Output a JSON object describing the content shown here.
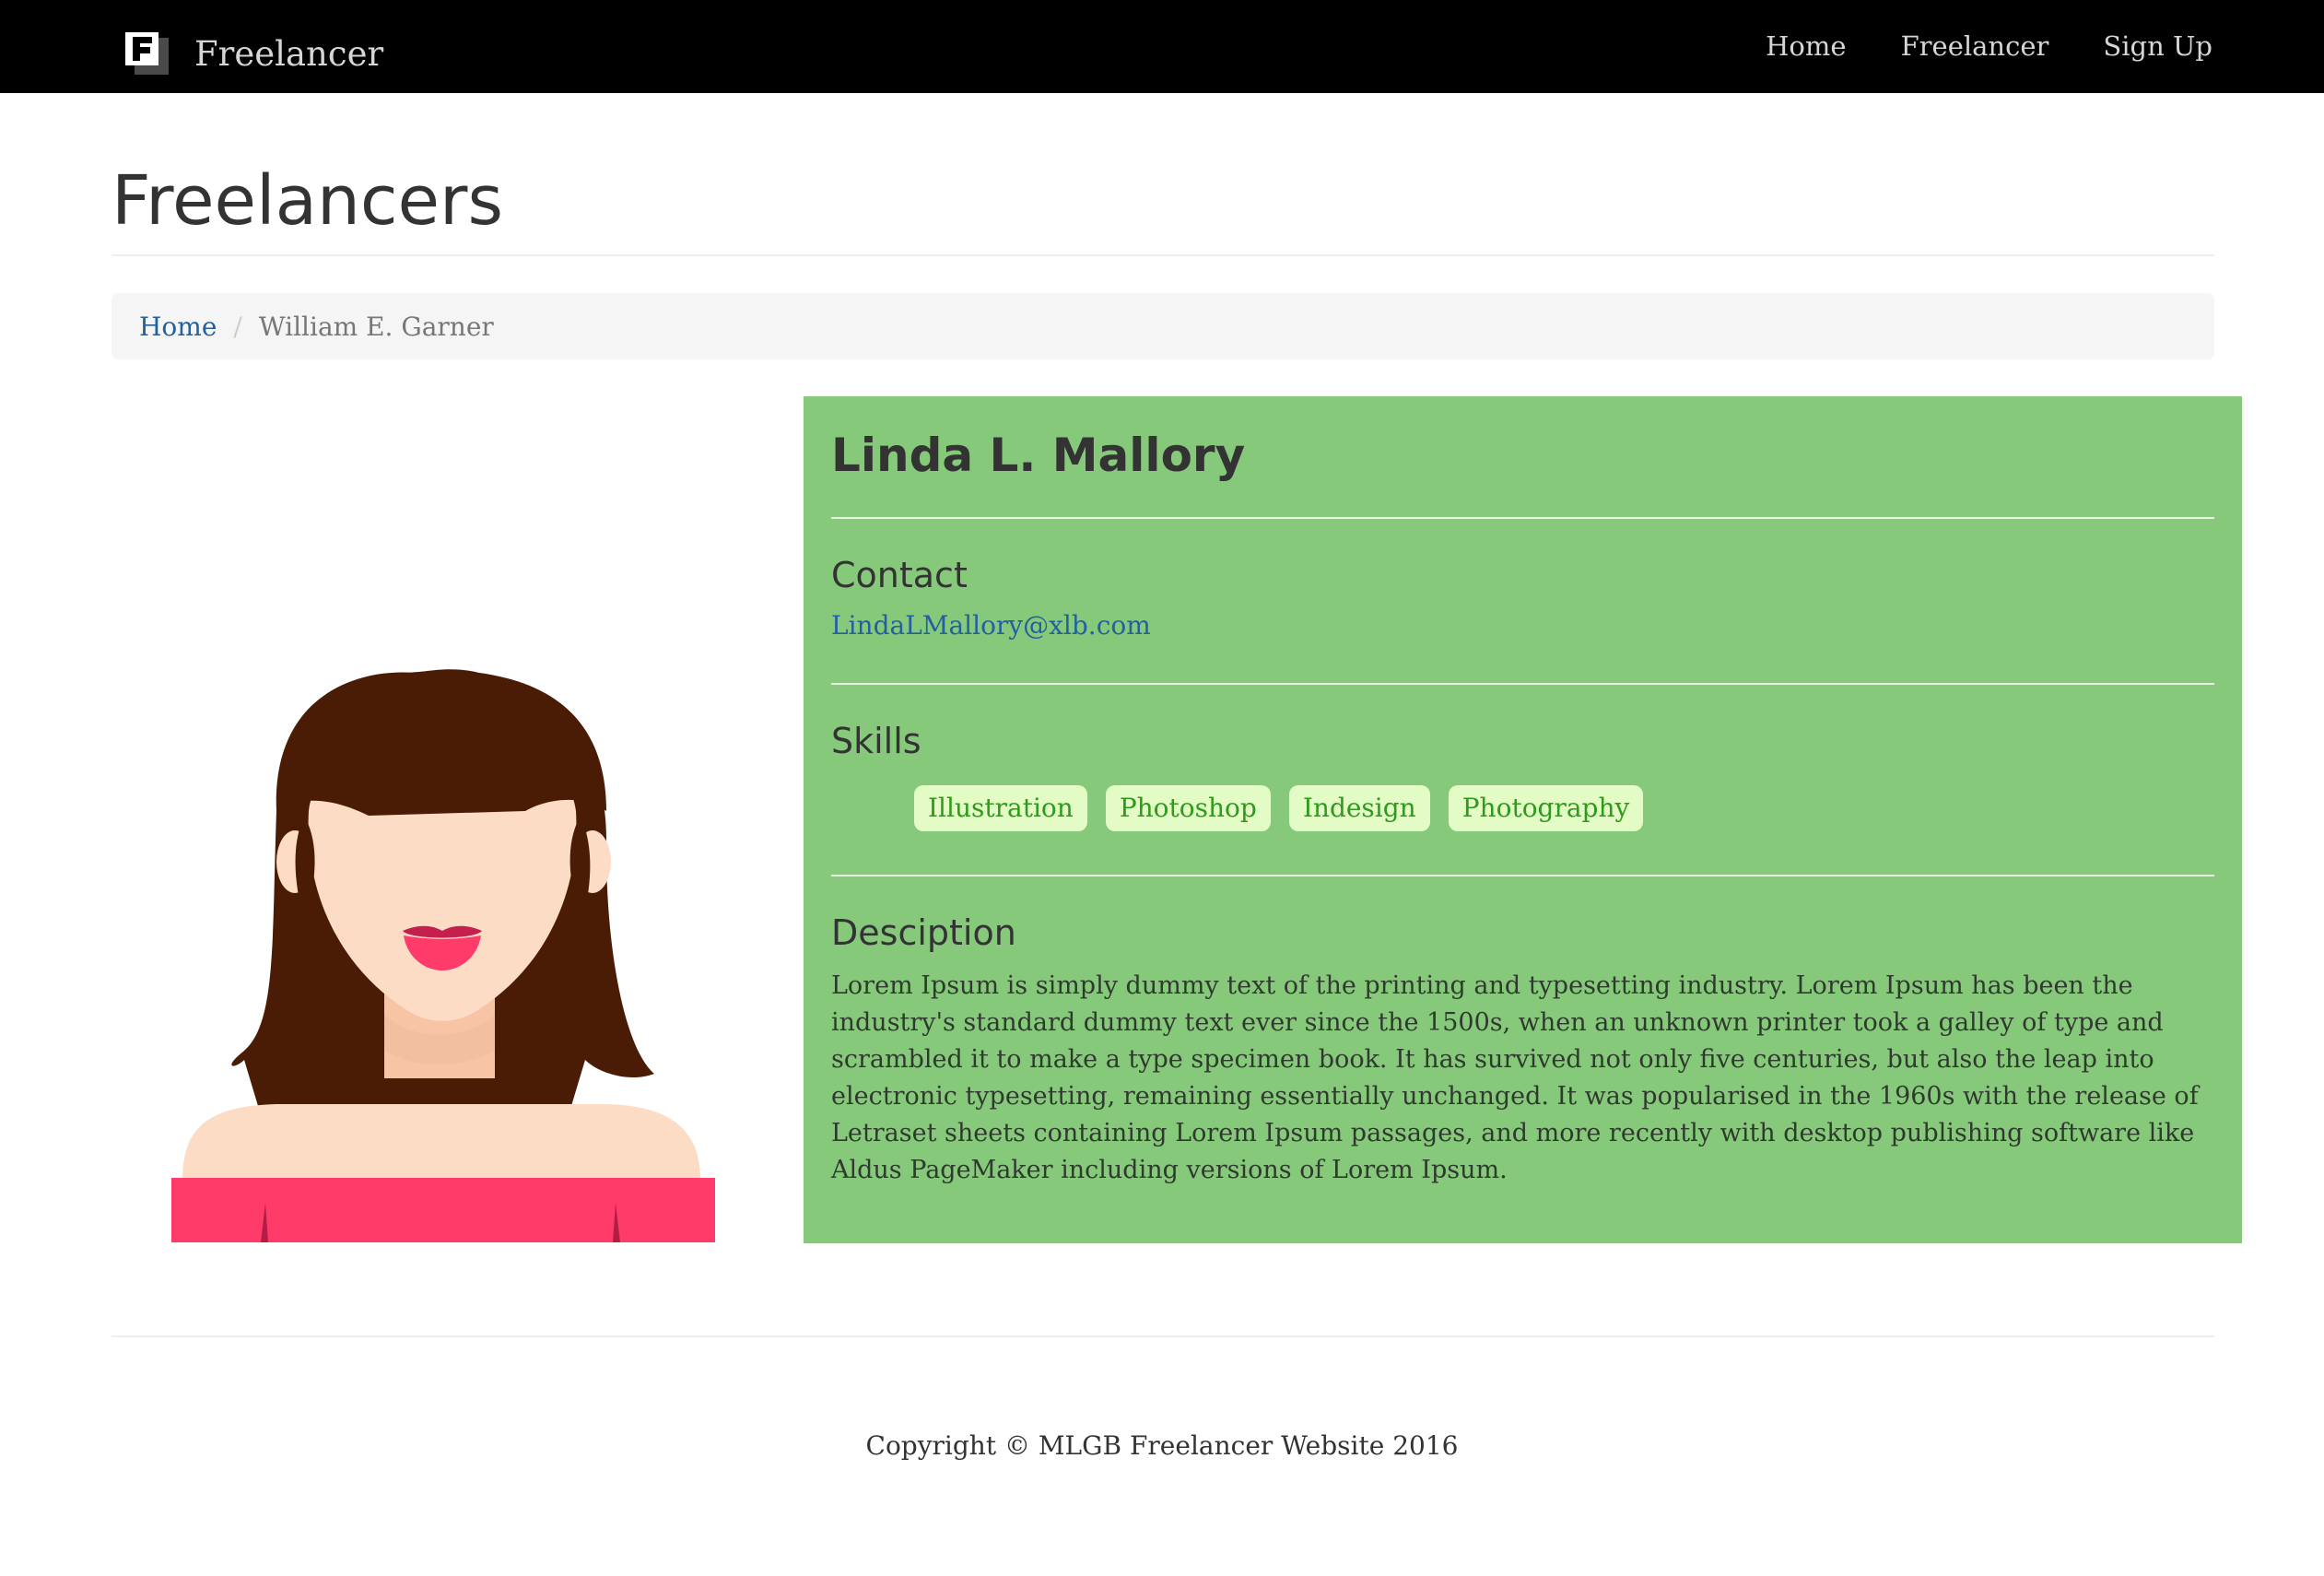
{
  "navbar": {
    "brand_icon": "freelancer-f-logo-icon",
    "brand_name": "Freelancer",
    "links": [
      {
        "label": "Home"
      },
      {
        "label": "Freelancer"
      },
      {
        "label": "Sign Up"
      }
    ]
  },
  "header": {
    "title": "Freelancers"
  },
  "breadcrumb": {
    "home_label": "Home",
    "separator": "/",
    "current": "William E. Garner"
  },
  "avatar": {
    "icon": "woman-avatar-illustration"
  },
  "profile": {
    "name": "Linda L. Mallory",
    "contact_heading": "Contact",
    "email": "LindaLMallory@xlb.com",
    "skills_heading": "Skills",
    "skills": [
      "Illustration",
      "Photoshop",
      "Indesign",
      "Photography"
    ],
    "description_heading": "Desciption",
    "description": "Lorem Ipsum is simply dummy text of the printing and typesetting industry. Lorem Ipsum has been the industry's standard dummy text ever since the 1500s, when an unknown printer took a galley of type and scrambled it to make a type specimen book. It has survived not only five centuries, but also the leap into electronic typesetting, remaining essentially unchanged. It was popularised in the 1960s with the release of Letraset sheets containing Lorem Ipsum passages, and more recently with desktop publishing software like Aldus PageMaker including versions of Lorem Ipsum."
  },
  "footer": {
    "copyright": "Copyright © MLGB Freelancer Website 2016"
  },
  "colors": {
    "navbar_bg": "#000000",
    "panel_bg": "#86c97b",
    "link": "#23609e",
    "skill_bg": "#e3fbc4",
    "skill_text": "#2f9a1c"
  }
}
